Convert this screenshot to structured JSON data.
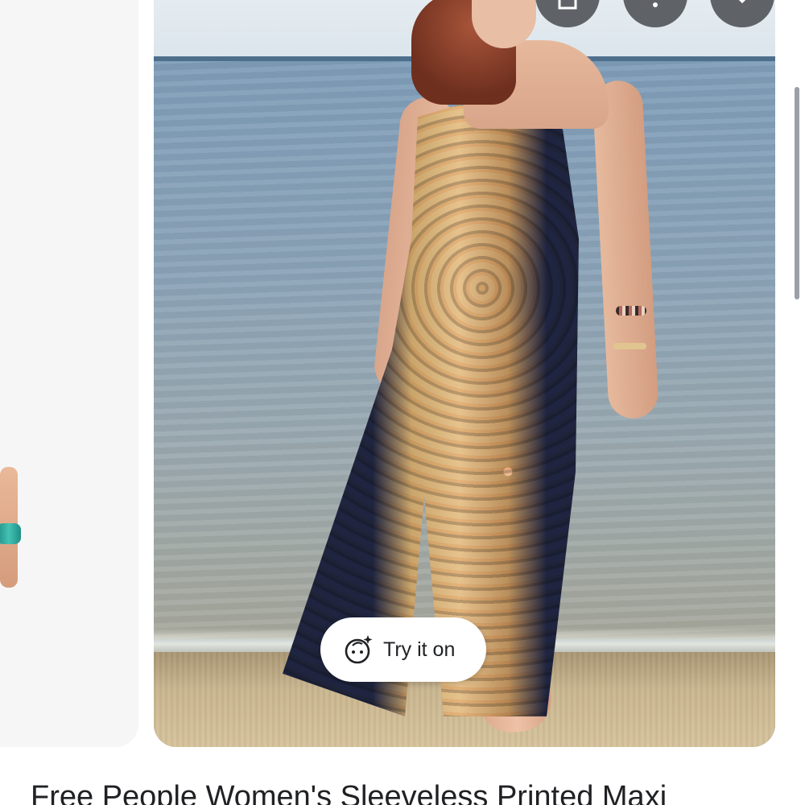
{
  "product": {
    "title": "Free People Women's Sleeveless Printed Maxi"
  },
  "actions": {
    "try_on_label": "Try it on",
    "save_icon": "bookmark-icon",
    "more_icon": "more-vert-icon",
    "close_icon": "close-icon",
    "try_on_icon": "face-sparkle-icon"
  },
  "colors": {
    "overlay_button": "#5f6368",
    "pill_background": "#ffffff",
    "text": "#202124"
  }
}
